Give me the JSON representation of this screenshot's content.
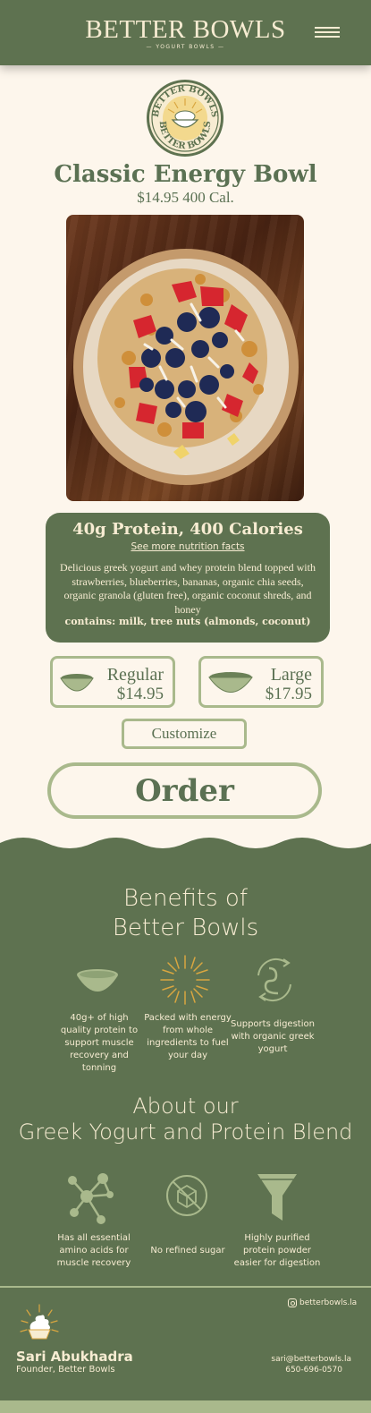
{
  "header": {
    "brand": "BETTER BOWLS",
    "tagline": "— YOGURT BOWLS —",
    "menu_icon": "hamburger-menu-icon"
  },
  "logo": {
    "alt": "BETTER BOWLS logo"
  },
  "product": {
    "name": "Classic Energy Bowl",
    "price_cal": "$14.95 400 Cal.",
    "photo": "yogurt-bowl-photo"
  },
  "info": {
    "heading": "40g Protein, 400 Calories",
    "link": "See more nutrition facts",
    "description": "Delicious greek yogurt and whey protein blend topped with strawberries, blueberries, bananas, organic chia seeds, organic granola (gluten free), organic coconut shreds, and honey",
    "contains": "contains: milk, tree nuts (almonds, coconut)"
  },
  "sizes": [
    {
      "name": "Regular",
      "price": "$14.95",
      "icon": "bowl-icon"
    },
    {
      "name": "Large",
      "price": "$17.95",
      "icon": "bowl-icon"
    }
  ],
  "customize_label": "Customize",
  "order_label": "Order",
  "benefits": {
    "heading_line1": "Benefits of",
    "heading_line2": "Better Bowls",
    "items": [
      {
        "icon": "bowl-icon",
        "text": "40g+ of high quality protein to support muscle recovery and tonning"
      },
      {
        "icon": "sun-burst-icon",
        "text": "Packed with energy from whole ingredients to fuel your day"
      },
      {
        "icon": "digestion-icon",
        "text": "Supports digestion with organic greek yogurt"
      }
    ]
  },
  "about": {
    "heading_line1": "About our",
    "heading_line2": "Greek Yogurt and Protein Blend",
    "items": [
      {
        "icon": "molecule-icon",
        "text": "Has all essential amino acids for muscle recovery"
      },
      {
        "icon": "no-sugar-icon",
        "text": "No reﬁned sugar"
      },
      {
        "icon": "funnel-icon",
        "text": "Highly puriﬁed protein powder easier for digestion"
      }
    ]
  },
  "footer": {
    "instagram": "betterbowls.la",
    "founder_name": "Sari Abukhadra",
    "founder_role": "Founder, Better Bowls",
    "email": "sari@betterbowls.la",
    "phone": "650-696-0570"
  },
  "colors": {
    "green": "#5e7250",
    "sage": "#a9b98c",
    "cream": "#fdf6ec",
    "text_cream": "#f7ecd2",
    "gold": "#d9a640"
  }
}
